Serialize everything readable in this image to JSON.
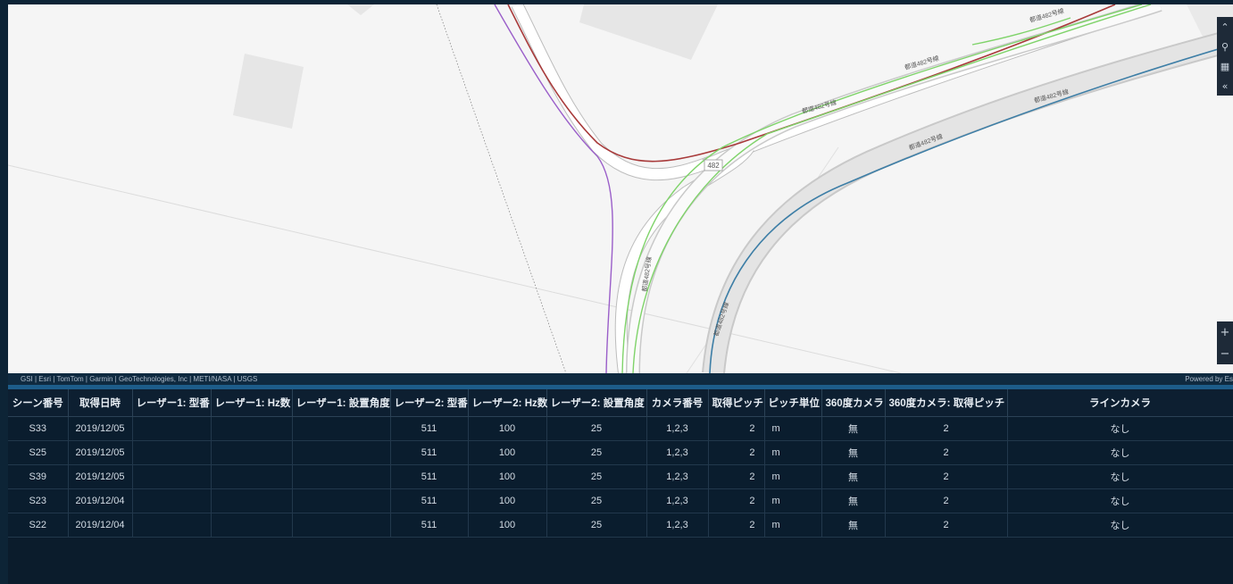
{
  "map": {
    "road_labels": [
      "都道482号線",
      "都道482号線",
      "都道482号線",
      "都道482号線",
      "都道482号線",
      "都道482号線",
      "都道482号線"
    ],
    "route_shield": "482",
    "attribution": "GSI | Esri | TomTom | Garmin | GeoTechnologies, Inc | METI/NASA | USGS",
    "powered_by": "Powered by Es",
    "controls": [
      {
        "icon": "double-chevron-up-icon",
        "glyph": "⌃"
      },
      {
        "icon": "search-icon",
        "glyph": "⚲"
      },
      {
        "icon": "grid-icon",
        "glyph": "▦"
      },
      {
        "icon": "double-chevron-left-icon",
        "glyph": "«"
      }
    ],
    "zoom": {
      "in": "+",
      "out": "−"
    }
  },
  "table": {
    "columns": [
      "シーン番号",
      "取得日時",
      "レーザー1: 型番",
      "レーザー1: Hz数",
      "レーザー1: 設置角度",
      "レーザー2: 型番",
      "レーザー2: Hz数",
      "レーザー2: 設置角度",
      "カメラ番号",
      "取得ピッチ",
      "ピッチ単位",
      "360度カメラ",
      "360度カメラ: 取得ピッチ",
      "ラインカメラ"
    ],
    "rows": [
      [
        "S33",
        "2019/12/05",
        "",
        "",
        "",
        "511",
        "100",
        "25",
        "1,2,3",
        "2",
        "m",
        "無",
        "2",
        "なし"
      ],
      [
        "S25",
        "2019/12/05",
        "",
        "",
        "",
        "511",
        "100",
        "25",
        "1,2,3",
        "2",
        "m",
        "無",
        "2",
        "なし"
      ],
      [
        "S39",
        "2019/12/05",
        "",
        "",
        "",
        "511",
        "100",
        "25",
        "1,2,3",
        "2",
        "m",
        "無",
        "2",
        "なし"
      ],
      [
        "S23",
        "2019/12/04",
        "",
        "",
        "",
        "511",
        "100",
        "25",
        "1,2,3",
        "2",
        "m",
        "無",
        "2",
        "なし"
      ],
      [
        "S22",
        "2019/12/04",
        "",
        "",
        "",
        "511",
        "100",
        "25",
        "1,2,3",
        "2",
        "m",
        "無",
        "2",
        "なし"
      ]
    ]
  },
  "colors": {
    "route_red": "#a83a3a",
    "route_green": "#7fd36a",
    "route_purple": "#9a5ec9",
    "route_blue": "#3d7ea6"
  }
}
